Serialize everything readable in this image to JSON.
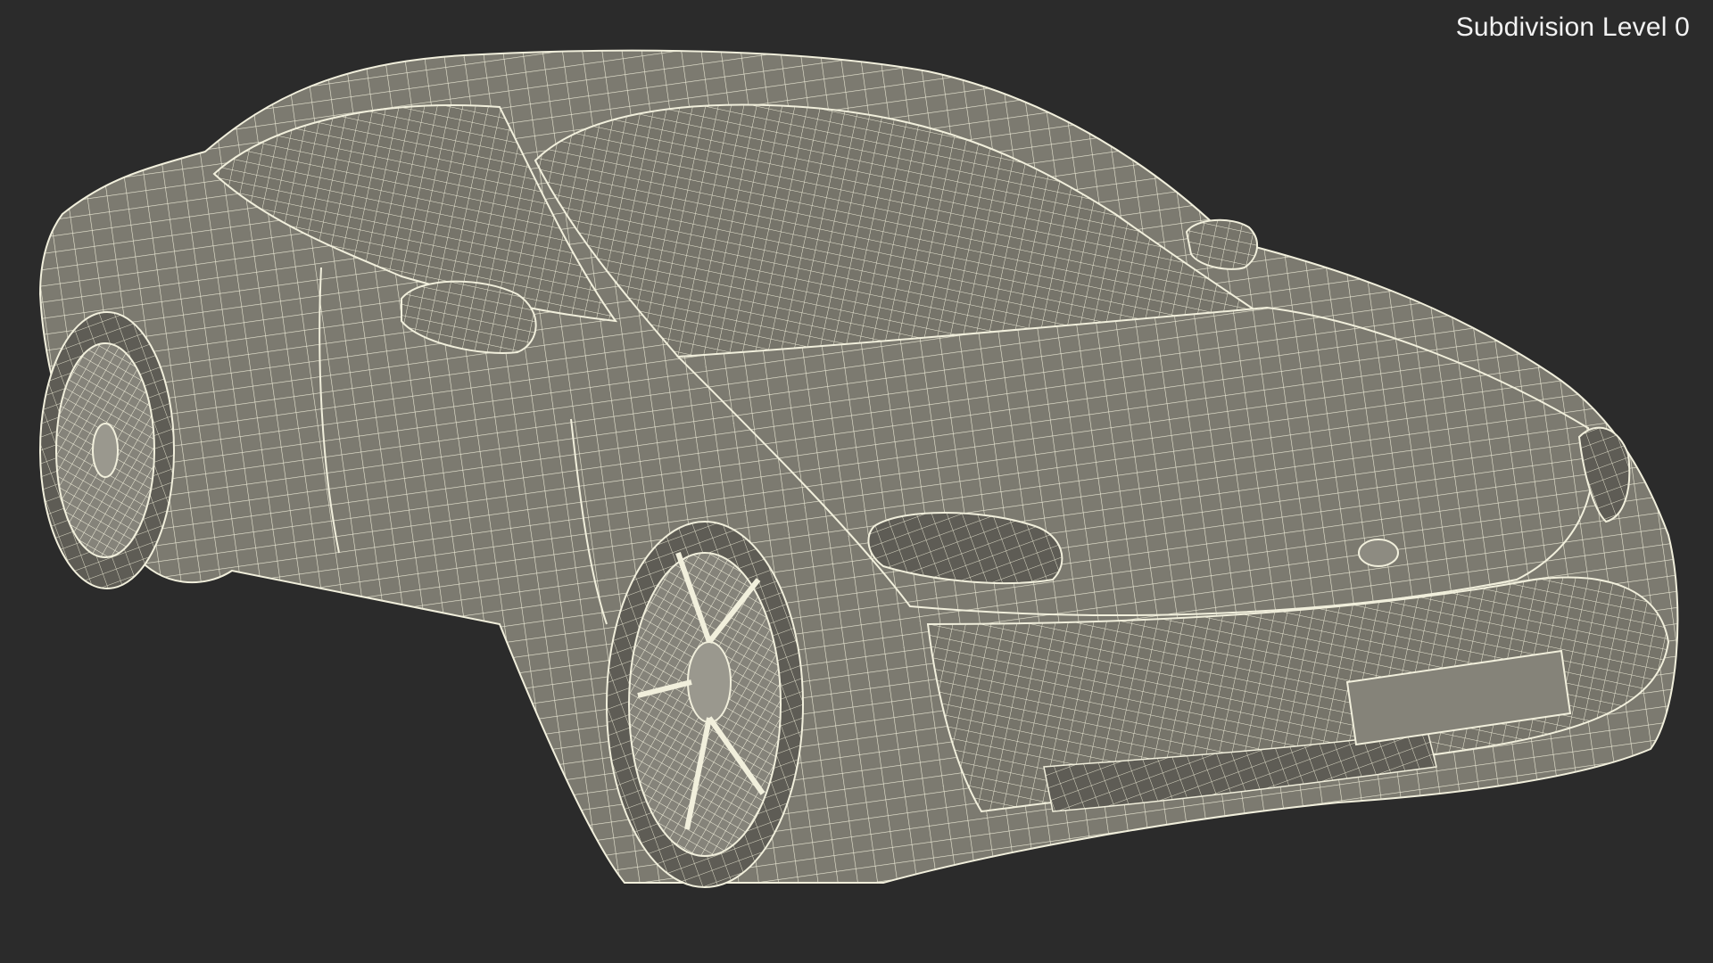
{
  "viewport": {
    "label": "Subdivision Level 0",
    "background": "#2b2b2b",
    "surface_color": "#7c7a70",
    "wire_color": "#f1efdc"
  },
  "model": {
    "icon": "wireframe-car-render"
  }
}
